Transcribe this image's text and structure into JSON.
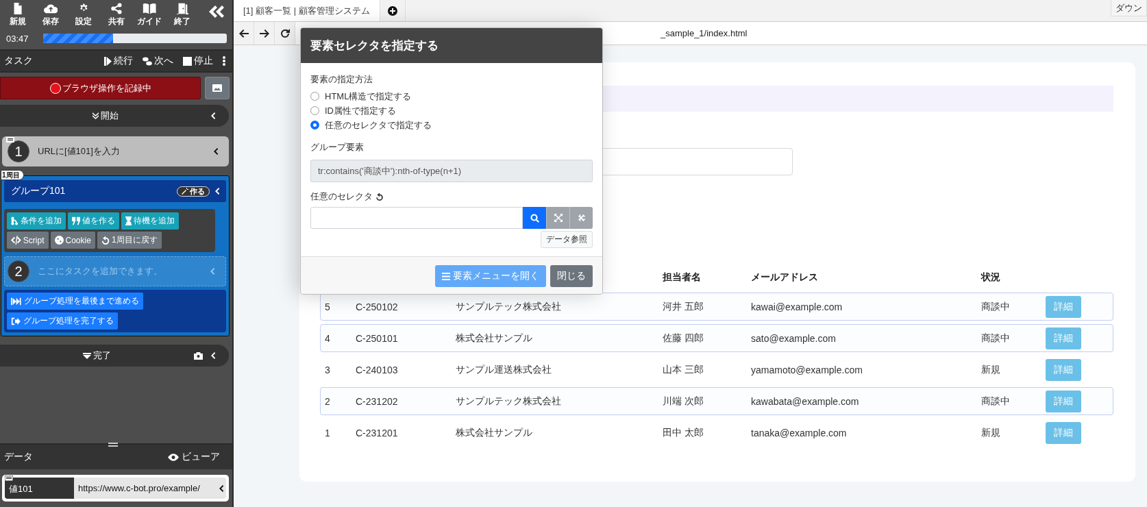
{
  "toolbar": {
    "items": [
      {
        "kind": "file",
        "label": "新規"
      },
      {
        "kind": "upload",
        "label": "保存"
      },
      {
        "kind": "gear",
        "label": "設定"
      },
      {
        "kind": "share",
        "label": "共有"
      },
      {
        "kind": "book",
        "label": "ガイド"
      },
      {
        "kind": "door",
        "label": "終了"
      }
    ],
    "timer": "03:47",
    "progress": {
      "level": 0.38
    }
  },
  "task_header": {
    "title": "タスク",
    "actions": [
      {
        "kind": "play",
        "label": "続行"
      },
      {
        "kind": "step",
        "label": "次へ"
      },
      {
        "kind": "stop",
        "label": "停止"
      }
    ]
  },
  "record_button": {
    "label": "ブラウザ操作を記録中"
  },
  "start_block": {
    "label": "開始"
  },
  "steps": [
    {
      "number": "1",
      "label": "URLに[値101]を入力"
    }
  ],
  "group": {
    "loop_badge": "1周目",
    "title": "グループ101",
    "make_badge": "作る",
    "tools": [
      {
        "kind": "branch",
        "label": "条件を追加",
        "color": "#17a2b8"
      },
      {
        "kind": "quote",
        "label": "値を作る",
        "color": "#17a2b8"
      },
      {
        "kind": "hourglass",
        "label": "待機を追加",
        "color": "#17a2b8"
      },
      {
        "kind": "code",
        "label": "Script",
        "color": "#6c757d"
      },
      {
        "kind": "cookie",
        "label": "Cookie",
        "color": "#6c757d"
      },
      {
        "kind": "undo",
        "label": "1周目に戻す",
        "color": "#6c757d"
      }
    ],
    "step": {
      "number": "2",
      "placeholder": "ここにタスクを追加できます。"
    },
    "actions": [
      {
        "kind": "forward",
        "label": "グループ処理を最後まで進める"
      },
      {
        "kind": "exit",
        "label": "グループ処理を完了する"
      }
    ]
  },
  "end_block": {
    "label": "完了"
  },
  "data_panel": {
    "title": "データ",
    "viewer": "ビューア",
    "rows": [
      {
        "name": "値101",
        "value": "https://www.c-bot.pro/example/"
      }
    ]
  },
  "browser": {
    "tabs": [
      {
        "label": "[1] 顧客一覧 | 顧客管理システム",
        "selected": true
      }
    ],
    "download_button": "ダウン",
    "address": "_sample_1/index.html"
  },
  "table": {
    "header": {
      "column_4": "担当者名",
      "column_5": "メールアドレス",
      "column_6": "状況"
    },
    "rows": [
      {
        "cells": [
          "5",
          "C-250102",
          "サンプルテック株式会社",
          "河井 五郎",
          "kawai@example.com",
          "商談中"
        ],
        "button": "詳細",
        "highlighted": true
      },
      {
        "cells": [
          "4",
          "C-250101",
          "株式会社サンプル",
          "佐藤 四郎",
          "sato@example.com",
          "商談中"
        ],
        "button": "詳細",
        "highlighted": true
      },
      {
        "cells": [
          "3",
          "C-240103",
          "サンプル運送株式会社",
          "山本 三郎",
          "yamamoto@example.com",
          "新規"
        ],
        "button": "詳細",
        "highlighted": false
      },
      {
        "cells": [
          "2",
          "C-231202",
          "サンプルテック株式会社",
          "川端 次郎",
          "kawabata@example.com",
          "商談中"
        ],
        "button": "詳細",
        "highlighted": true
      },
      {
        "cells": [
          "1",
          "C-231201",
          "株式会社サンプル",
          "田中 太郎",
          "tanaka@example.com",
          "新規"
        ],
        "button": "詳細",
        "highlighted": false
      }
    ]
  },
  "dialog": {
    "title": "要素セレクタを指定する",
    "method_label": "要素の指定方法",
    "methods": [
      {
        "label": "HTML構造で指定する",
        "selected": false
      },
      {
        "label": "ID属性で指定する",
        "selected": false
      },
      {
        "label": "任意のセレクタで指定する",
        "selected": true
      }
    ],
    "group_label": "グループ要素",
    "group_value": "tr:contains('商談中'):nth-of-type(n+1)",
    "selector_label": "任意のセレクタ",
    "data_ref_button": "データ参照",
    "open_menu_button": "要素メニューを開く",
    "close_button": "閉じる"
  }
}
